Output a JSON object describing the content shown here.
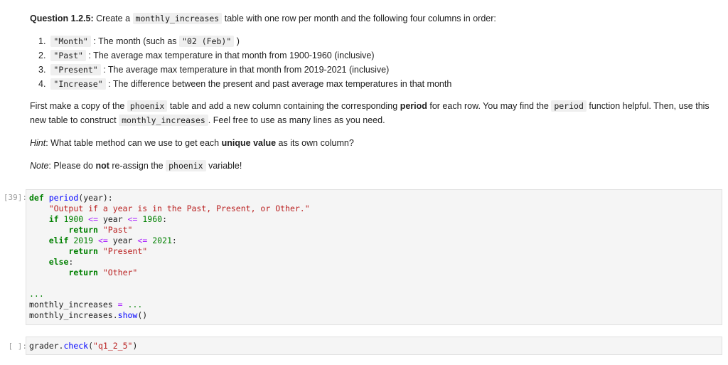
{
  "question": {
    "label": "Question 1.2.5:",
    "intro_before": "Create a",
    "table_name": "monthly_increases",
    "intro_after": "table with one row per month and the following four columns in order:"
  },
  "columns": [
    {
      "num": "1.",
      "name": "\"Month\"",
      "desc_before": ": The month (such as",
      "example": "\"02 (Feb)\"",
      "desc_after": ")"
    },
    {
      "num": "2.",
      "name": "\"Past\"",
      "desc_before": ": The average max temperature in that month from 1900-1960 (inclusive)",
      "example": "",
      "desc_after": ""
    },
    {
      "num": "3.",
      "name": "\"Present\"",
      "desc_before": ": The average max temperature in that month from 2019-2021 (inclusive)",
      "example": "",
      "desc_after": ""
    },
    {
      "num": "4.",
      "name": "\"Increase\"",
      "desc_before": ": The difference between the present and past average max temperatures in that month",
      "example": "",
      "desc_after": ""
    }
  ],
  "paragraph": {
    "p1": "First make a copy of the",
    "c1": "phoenix",
    "p2": "table and add a new column containing the corresponding",
    "b1": "period",
    "p3": "for each row. You may find the",
    "c2": "period",
    "p4": "function helpful. Then, use this new table to construct",
    "c3": "monthly_increases",
    "p5": ". Feel free to use as many lines as you need."
  },
  "hint": {
    "label": "Hint",
    "p1": ": What table method can we use to get each",
    "bold": "unique value",
    "p2": "as its own column?"
  },
  "note": {
    "label": "Note",
    "p1": ": Please do",
    "bold": "not",
    "p2": "re-assign the",
    "code": "phoenix",
    "p3": "variable!"
  },
  "cells": [
    {
      "prompt": "[39]:",
      "code": {
        "l1_def": "def",
        "l1_name": "period",
        "l1_rest": "(year):",
        "l2": "\"Output if a year is in the Past, Present, or Other.\"",
        "l3_if": "if",
        "l3_a": "1900",
        "l3_op1": "<=",
        "l3_mid": "year",
        "l3_op2": "<=",
        "l3_b": "1960",
        "l3_end": ":",
        "l4_ret": "return",
        "l4_val": "\"Past\"",
        "l5_elif": "elif",
        "l5_a": "2019",
        "l5_op1": "<=",
        "l5_mid": "year",
        "l5_op2": "<=",
        "l5_b": "2021",
        "l5_end": ":",
        "l6_ret": "return",
        "l6_val": "\"Present\"",
        "l7_else": "else",
        "l7_end": ":",
        "l8_ret": "return",
        "l8_val": "\"Other\"",
        "l10": "...",
        "l11_var": "monthly_increases",
        "l11_eq": "=",
        "l11_val": "...",
        "l12_var": "monthly_increases",
        "l12_dot": ".",
        "l12_fn": "show",
        "l12_end": "()"
      }
    },
    {
      "prompt": "[ ]:",
      "code": {
        "g_obj": "grader",
        "g_dot": ".",
        "g_fn": "check",
        "g_open": "(",
        "g_arg": "\"q1_2_5\"",
        "g_close": ")"
      }
    }
  ]
}
